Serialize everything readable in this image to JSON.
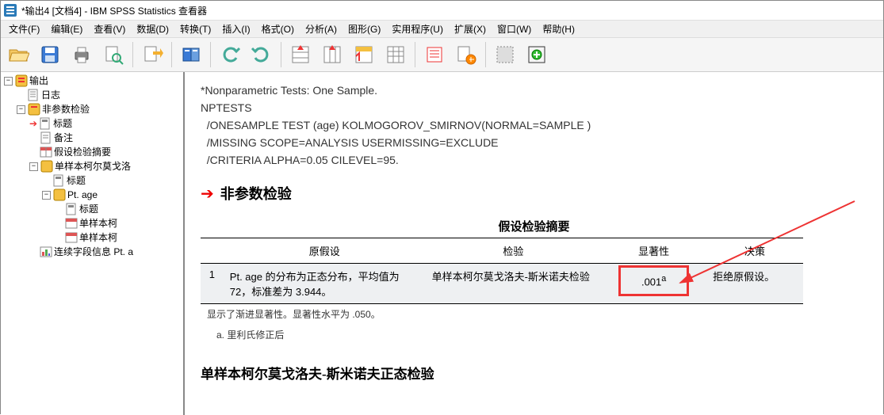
{
  "window": {
    "title": "*输出4 [文档4] - IBM SPSS Statistics 查看器"
  },
  "menu": {
    "file": "文件(F)",
    "edit": "编辑(E)",
    "view": "查看(V)",
    "data": "数据(D)",
    "transform": "转换(T)",
    "insert": "插入(I)",
    "format": "格式(O)",
    "analyze": "分析(A)",
    "graphs": "图形(G)",
    "utilities": "实用程序(U)",
    "extensions": "扩展(X)",
    "window": "窗口(W)",
    "help": "帮助(H)"
  },
  "tree": {
    "root": "输出",
    "log": "日志",
    "nptests": "非参数检验",
    "title": "标题",
    "notes": "备注",
    "summary": "假设检验摘要",
    "oneSample": "单样本柯尔莫戈洛",
    "ptage": "Pt. age",
    "singleK": "单样本柯",
    "cont": "连续字段信息 Pt. a"
  },
  "syntax": {
    "l1": "*Nonparametric Tests: One Sample.",
    "l2": "NPTESTS",
    "l3": "  /ONESAMPLE TEST (age) KOLMOGOROV_SMIRNOV(NORMAL=SAMPLE )",
    "l4": "  /MISSING SCOPE=ANALYSIS USERMISSING=EXCLUDE",
    "l5": "  /CRITERIA ALPHA=0.05 CILEVEL=95."
  },
  "section": {
    "title": "非参数检验"
  },
  "pivot": {
    "caption": "假设检验摘要",
    "headers": {
      "h1": "原假设",
      "h2": "检验",
      "h3": "显著性",
      "h4": "决策"
    },
    "row": {
      "n": "1",
      "null": "Pt. age 的分布为正态分布，平均值为 72，标准差为 3.944。",
      "test": "单样本柯尔莫戈洛夫-斯米诺夫检验",
      "sig": ".001",
      "sig_sup": "a",
      "decision": "拒绝原假设。"
    },
    "foot1": "显示了渐进显著性。显著性水平为 .050。",
    "foot2": "a. 里利氏修正后"
  },
  "section2": {
    "title": "单样本柯尔莫戈洛夫-斯米诺夫正态检验"
  }
}
